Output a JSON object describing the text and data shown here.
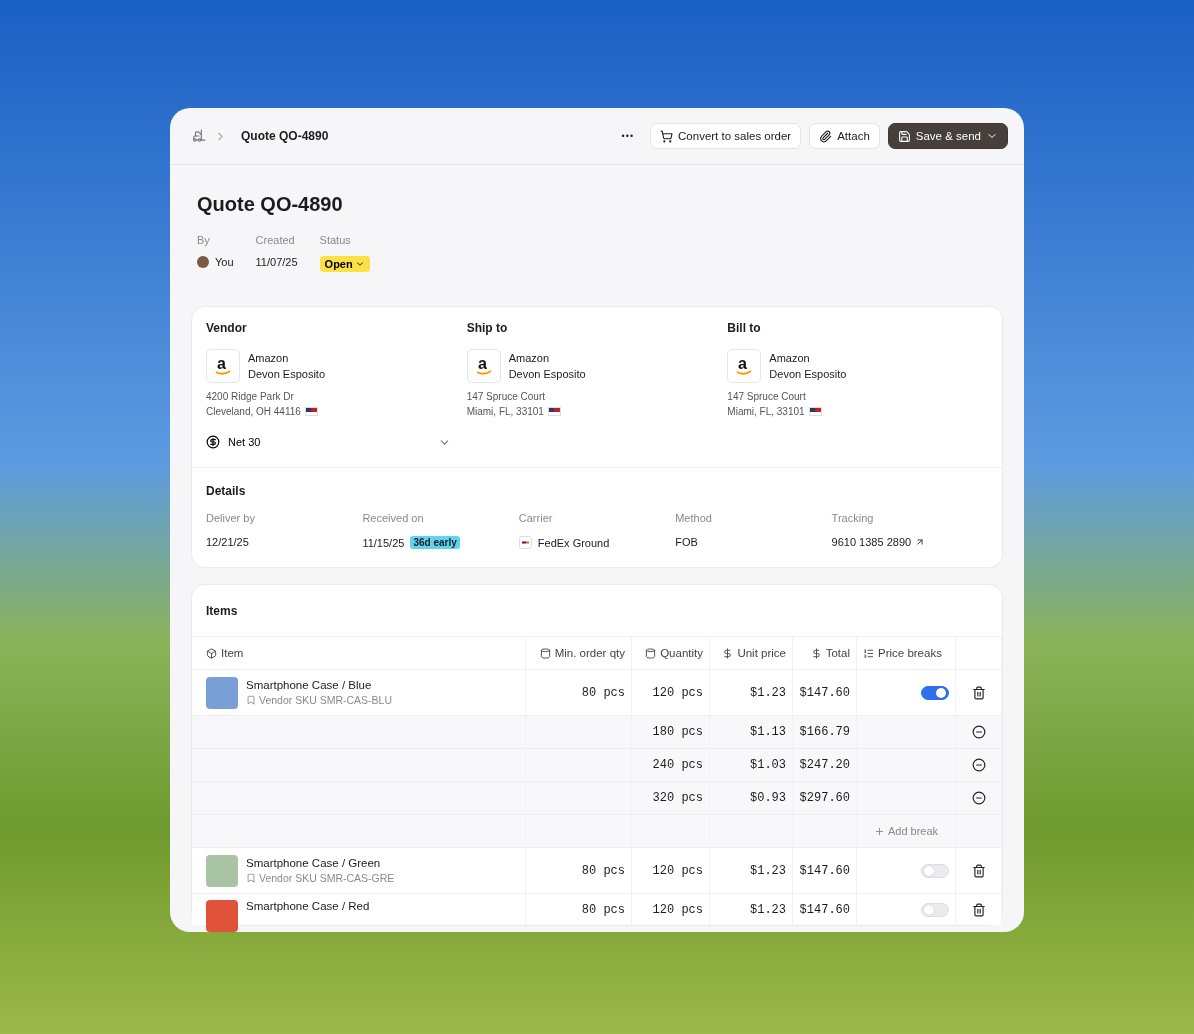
{
  "breadcrumb": {
    "current": "Quote QO-4890"
  },
  "toolbar": {
    "more": "•••",
    "buttons": [
      {
        "kind": "cart",
        "label": "Convert to sales order"
      },
      {
        "kind": "attach",
        "label": "Attach"
      },
      {
        "kind": "primary",
        "label": "Save & send"
      }
    ]
  },
  "title": "Quote QO-4890",
  "meta": [
    {
      "label": "By",
      "value": "You",
      "kind": "avatar"
    },
    {
      "label": "Created",
      "value": "11/07/25",
      "kind": "text"
    },
    {
      "label": "Status",
      "value": "Open",
      "kind": "status"
    }
  ],
  "parties": [
    {
      "heading": "Vendor",
      "logo": "a",
      "company": "Amazon",
      "contact": "Devon Esposito",
      "address": [
        "4200 Ridge Park Dr",
        "Cleveland, OH 44116"
      ]
    },
    {
      "heading": "Ship to",
      "logo": "a",
      "company": "Amazon",
      "contact": "Devon Esposito",
      "address": [
        "147 Spruce Court",
        "Miami, FL, 33101"
      ]
    },
    {
      "heading": "Bill to",
      "logo": "a",
      "company": "Amazon",
      "contact": "Devon Esposito",
      "address": [
        "147 Spruce Court",
        "Miami, FL, 33101"
      ]
    }
  ],
  "payment_terms": "Net 30",
  "details": {
    "heading": "Details",
    "fields": [
      {
        "label": "Deliver by",
        "value": "12/21/25",
        "kind": "text"
      },
      {
        "label": "Received on",
        "value": "11/15/25",
        "badge": "36d early",
        "kind": "badge"
      },
      {
        "label": "Carrier",
        "value": "FedEx Ground",
        "kind": "carrier"
      },
      {
        "label": "Method",
        "value": "FOB",
        "kind": "text"
      },
      {
        "label": "Tracking",
        "value": "9610 1385 2890",
        "kind": "link"
      }
    ]
  },
  "items": {
    "heading": "Items",
    "columns": [
      "Item",
      "Min. order qty",
      "Quantity",
      "Unit price",
      "Total",
      "Price breaks"
    ],
    "rows": [
      {
        "name": "Smartphone Case / Blue",
        "sku": "Vendor SKU SMR-CAS-BLU",
        "color": "#7a9fd6",
        "min_qty": "80 pcs",
        "quantity": "120 pcs",
        "unit_price": "$1.23",
        "total": "$147.60",
        "price_breaks": true,
        "breaks": [
          {
            "quantity": "180 pcs",
            "unit_price": "$1.13",
            "total": "$166.79"
          },
          {
            "quantity": "240 pcs",
            "unit_price": "$1.03",
            "total": "$247.20"
          },
          {
            "quantity": "320 pcs",
            "unit_price": "$0.93",
            "total": "$297.60"
          }
        ],
        "add_break": "Add break"
      },
      {
        "name": "Smartphone Case / Green",
        "sku": "Vendor SKU SMR-CAS-GRE",
        "color": "#a9c4a2",
        "min_qty": "80 pcs",
        "quantity": "120 pcs",
        "unit_price": "$1.23",
        "total": "$147.60",
        "price_breaks": false
      },
      {
        "name": "Smartphone Case / Red",
        "color": "#e0533a",
        "min_qty": "80 pcs",
        "quantity": "120 pcs",
        "unit_price": "$1.23",
        "total": "$147.60",
        "price_breaks": false
      }
    ]
  }
}
